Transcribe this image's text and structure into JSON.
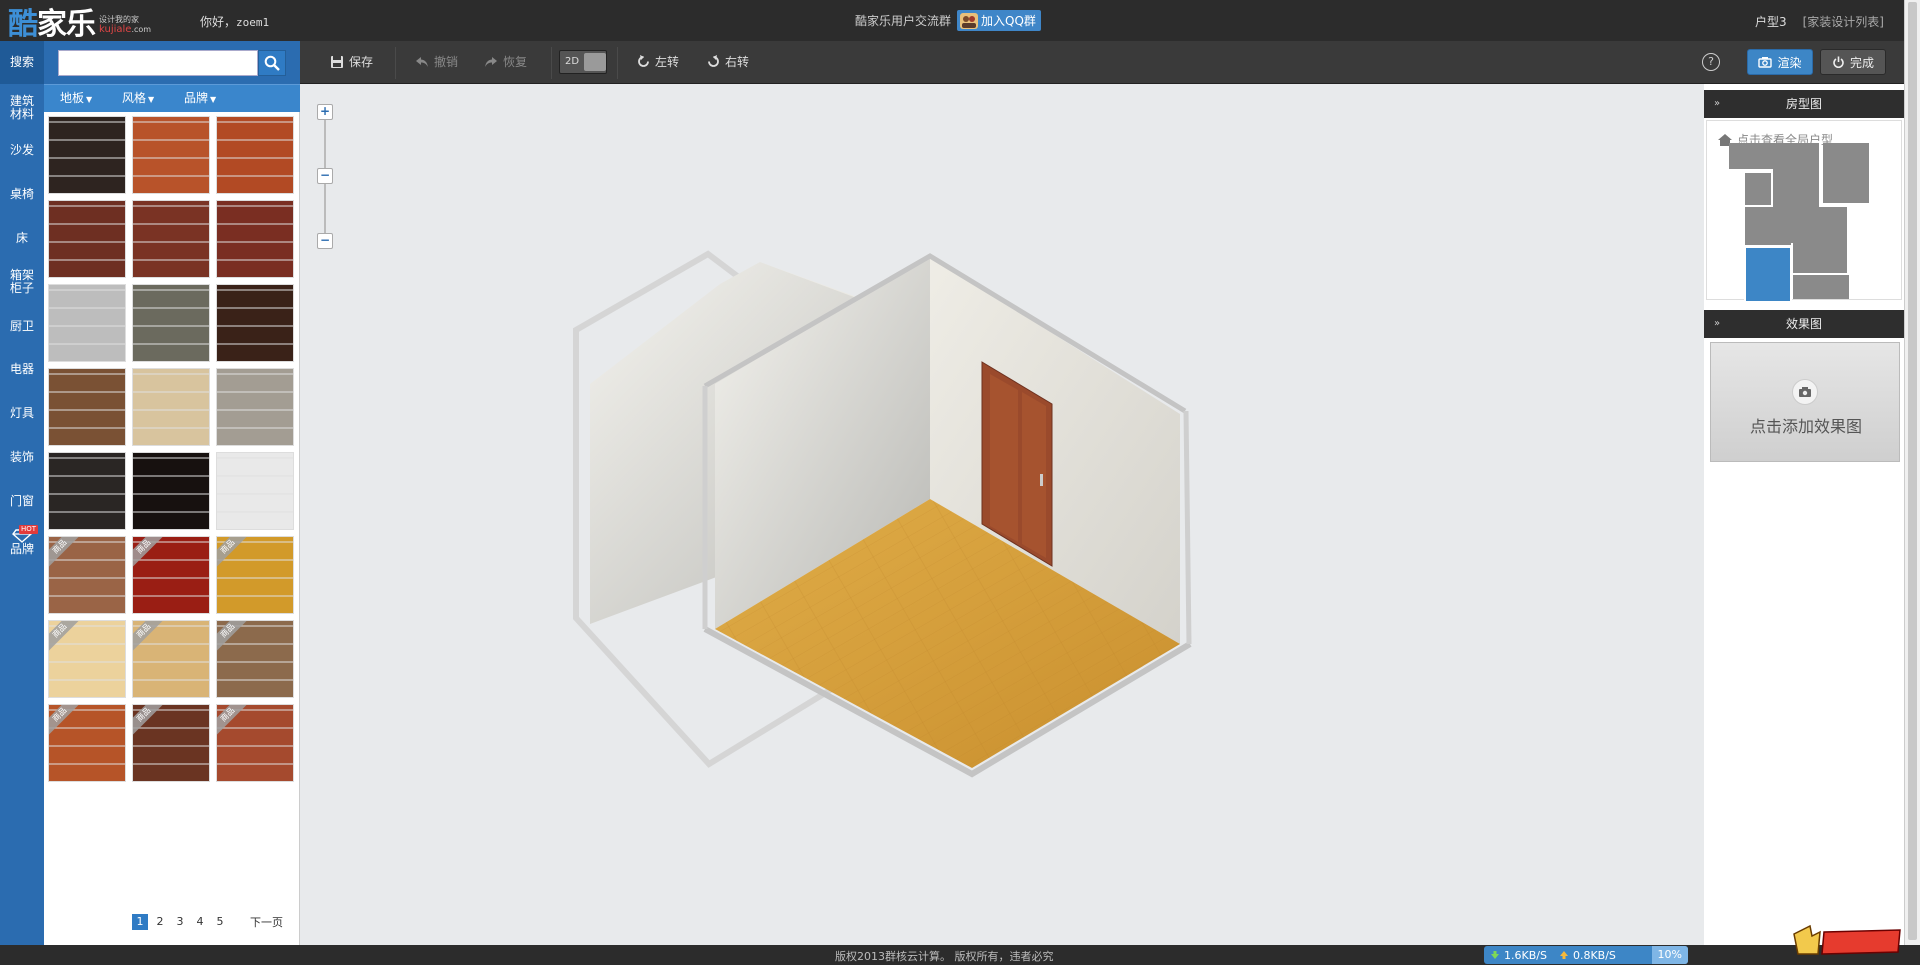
{
  "header": {
    "logo_char": "酷",
    "logo_text": "家乐",
    "logo_slogan": "设计我的家",
    "logo_domain_a": "kujiale",
    "logo_domain_b": ".com",
    "greeting": "你好，",
    "username": "zoem1",
    "group_text": "酷家乐用户交流群",
    "qq_button": "加入QQ群",
    "house_type": "户型3",
    "design_list": "[家装设计列表]"
  },
  "toolbar": {
    "save": "保存",
    "undo": "撤销",
    "redo": "恢复",
    "view_2d": "2D",
    "rotate_left": "左转",
    "rotate_right": "右转",
    "help": "?",
    "render": "渲染",
    "done": "完成"
  },
  "left_nav": {
    "items": [
      {
        "label": "搜索",
        "active": true
      },
      {
        "label": "建筑材料"
      },
      {
        "label": "沙发"
      },
      {
        "label": "桌椅"
      },
      {
        "label": "床"
      },
      {
        "label": "箱架柜子"
      },
      {
        "label": "厨卫"
      },
      {
        "label": "电器"
      },
      {
        "label": "灯具"
      },
      {
        "label": "装饰"
      },
      {
        "label": "门窗"
      },
      {
        "label": "品牌",
        "badge": "HOT"
      }
    ]
  },
  "search": {
    "placeholder": "",
    "filters": [
      "地板",
      "风格",
      "品牌"
    ]
  },
  "materials": {
    "tag_label": "商品",
    "tiles": [
      {
        "color": "#2e2420",
        "tagged": false
      },
      {
        "color": "#b8532a",
        "tagged": false
      },
      {
        "color": "#b24a24",
        "tagged": false
      },
      {
        "color": "#6e2f22",
        "tagged": false
      },
      {
        "color": "#7a3324",
        "tagged": false
      },
      {
        "color": "#7a2e22",
        "tagged": false
      },
      {
        "color": "#bdbdbd",
        "tagged": false
      },
      {
        "color": "#6b6a5e",
        "tagged": false
      },
      {
        "color": "#3a2218",
        "tagged": false
      },
      {
        "color": "#7a5134",
        "tagged": false
      },
      {
        "color": "#d8c49e",
        "tagged": false
      },
      {
        "color": "#a39d93",
        "tagged": false
      },
      {
        "color": "#2a2624",
        "tagged": false
      },
      {
        "color": "#17110f",
        "tagged": false
      },
      {
        "color": "#e9e9e9",
        "tagged": false
      },
      {
        "color": "#9a6446",
        "tagged": true
      },
      {
        "color": "#9a1e14",
        "tagged": true
      },
      {
        "color": "#d29a2a",
        "tagged": true
      },
      {
        "color": "#ecd29c",
        "tagged": true
      },
      {
        "color": "#d9b476",
        "tagged": true
      },
      {
        "color": "#8c6a4c",
        "tagged": true
      },
      {
        "color": "#b65428",
        "tagged": true
      },
      {
        "color": "#6a3422",
        "tagged": true
      },
      {
        "color": "#a54a2e",
        "tagged": true
      }
    ]
  },
  "pagination": {
    "pages": [
      "1",
      "2",
      "3",
      "4",
      "5"
    ],
    "current": "1",
    "next": "下一页"
  },
  "zoom": {
    "plus": "+",
    "minus": "−"
  },
  "right_panel": {
    "floorplan_title": "房型图",
    "floorplan_link": "点击查看全局户型",
    "effect_title": "效果图",
    "effect_add": "点击添加效果图"
  },
  "footer": {
    "copyright": "版权2013群核云计算。 版权所有，违者必究",
    "download": "1.6KB/S",
    "upload": "0.8KB/S",
    "percent": "10%"
  },
  "colors": {
    "accent": "#2b6cb0",
    "floor": "#d9a43f",
    "door": "#9a4a2c"
  }
}
